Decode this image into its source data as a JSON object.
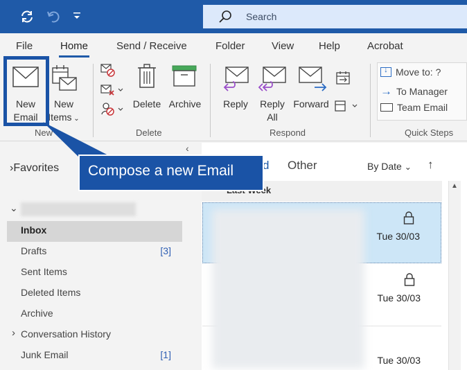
{
  "titlebar": {
    "search_placeholder": "Search",
    "icons": [
      "sync-icon",
      "undo-icon",
      "customize-qat-icon",
      "search-icon"
    ],
    "colors": {
      "titlebar": "#1f5aa8",
      "search_bg": "#dce9fb"
    }
  },
  "menu": {
    "tabs": [
      "File",
      "Home",
      "Send / Receive",
      "Folder",
      "View",
      "Help",
      "Acrobat"
    ],
    "active": "Home"
  },
  "ribbon": {
    "new_group": {
      "label": "New",
      "new_email": [
        "New",
        "Email"
      ],
      "new_items": [
        "New",
        "Items"
      ]
    },
    "delete_group": {
      "label": "Delete",
      "delete": "Delete",
      "archive": "Archive"
    },
    "respond_group": {
      "label": "Respond",
      "reply": "Reply",
      "reply_all": [
        "Reply",
        "All"
      ],
      "forward": "Forward"
    },
    "quick_steps_group": {
      "label": "Quick Steps",
      "items": [
        "Move to: ?",
        "To Manager",
        "Team Email"
      ]
    }
  },
  "callout": {
    "text": "Compose a new Email",
    "color": "#1a53a6"
  },
  "folders": {
    "favorites": "Favorites",
    "items": [
      {
        "name": "Inbox",
        "count": "",
        "selected": true
      },
      {
        "name": "Drafts",
        "count": "[3]"
      },
      {
        "name": "Sent Items",
        "count": ""
      },
      {
        "name": "Deleted Items",
        "count": ""
      },
      {
        "name": "Archive",
        "count": ""
      },
      {
        "name": "Conversation History",
        "count": ""
      },
      {
        "name": "Junk Email",
        "count": "[1]"
      }
    ]
  },
  "maillist": {
    "tabs": {
      "focused_partial": "d",
      "other": "Other"
    },
    "sort": "By Date",
    "group_header": "Last Week",
    "messages": [
      {
        "date": "Tue 30/03",
        "selected": true
      },
      {
        "date": "Tue 30/03",
        "selected": false
      },
      {
        "date": "Tue 30/03",
        "selected": false
      }
    ]
  }
}
